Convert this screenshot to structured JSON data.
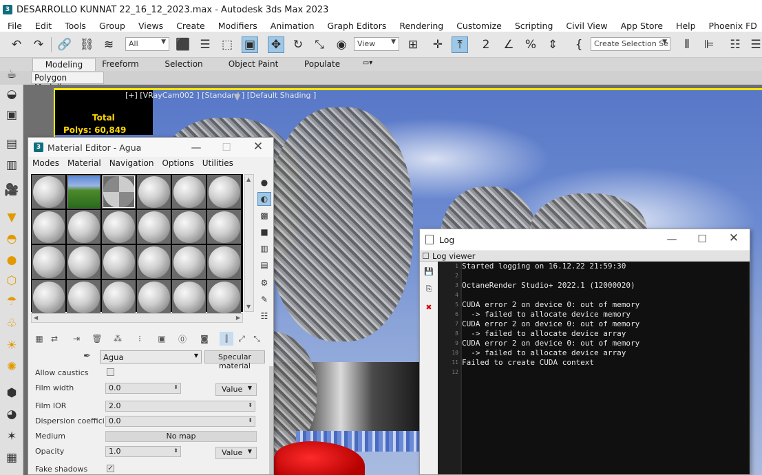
{
  "app": {
    "logo_text": "3",
    "title": "DESARROLLO KUNNAT 22_16_12_2023.max - Autodesk 3ds Max 2023"
  },
  "menu": [
    "File",
    "Edit",
    "Tools",
    "Group",
    "Views",
    "Create",
    "Modifiers",
    "Animation",
    "Graph Editors",
    "Rendering",
    "Customize",
    "Scripting",
    "Civil View",
    "App Store",
    "Help",
    "Phoenix FD"
  ],
  "toolbar": {
    "filter_value": "All",
    "view_value": "View",
    "selection_set_placeholder": "Create Selection Se"
  },
  "ribbon": {
    "tabs": [
      "Modeling",
      "Freeform",
      "Selection",
      "Object Paint",
      "Populate"
    ],
    "sub_tab": "Polygon Modeling"
  },
  "viewport": {
    "label": "[+] [VRayCam002 ] [Standard ] [Default Shading ]",
    "stats_total": "Total",
    "stats_polys": "Polys:  60,849"
  },
  "material_editor": {
    "logo_text": "3",
    "title": "Material Editor - Agua",
    "menu": [
      "Modes",
      "Material",
      "Navigation",
      "Options",
      "Utilities"
    ],
    "material_name": "Agua",
    "material_type": "Specular material",
    "params": {
      "allow_caustics_label": "Allow caustics",
      "allow_caustics_checked": "",
      "film_width_label": "Film width",
      "film_width_value": "0.0",
      "film_width_mode": "Value",
      "film_ior_label": "Film IOR",
      "film_ior_value": "2.0",
      "dispersion_label": "Dispersion coeffici...",
      "dispersion_value": "0.0",
      "medium_label": "Medium",
      "medium_value": "No map",
      "opacity_label": "Opacity",
      "opacity_value": "1.0",
      "opacity_mode": "Value",
      "fake_shadows_label": "Fake shadows",
      "fake_shadows_checked": "✓"
    }
  },
  "log": {
    "title": "Log",
    "viewer_label": "Log viewer",
    "lines": [
      "Started logging on 16.12.22 21:59:30",
      "",
      "OctaneRender Studio+ 2022.1 (12000020)",
      "",
      "CUDA error 2 on device 0: out of memory",
      "  -> failed to allocate device memory",
      "CUDA error 2 on device 0: out of memory",
      "  -> failed to allocate device array",
      "CUDA error 2 on device 0: out of memory",
      "  -> failed to allocate device array",
      "Failed to create CUDA context",
      ""
    ],
    "line_numbers": [
      "1",
      "2",
      "3",
      "4",
      "5",
      "6",
      "7",
      "8",
      "9",
      "10",
      "11",
      "12"
    ]
  }
}
